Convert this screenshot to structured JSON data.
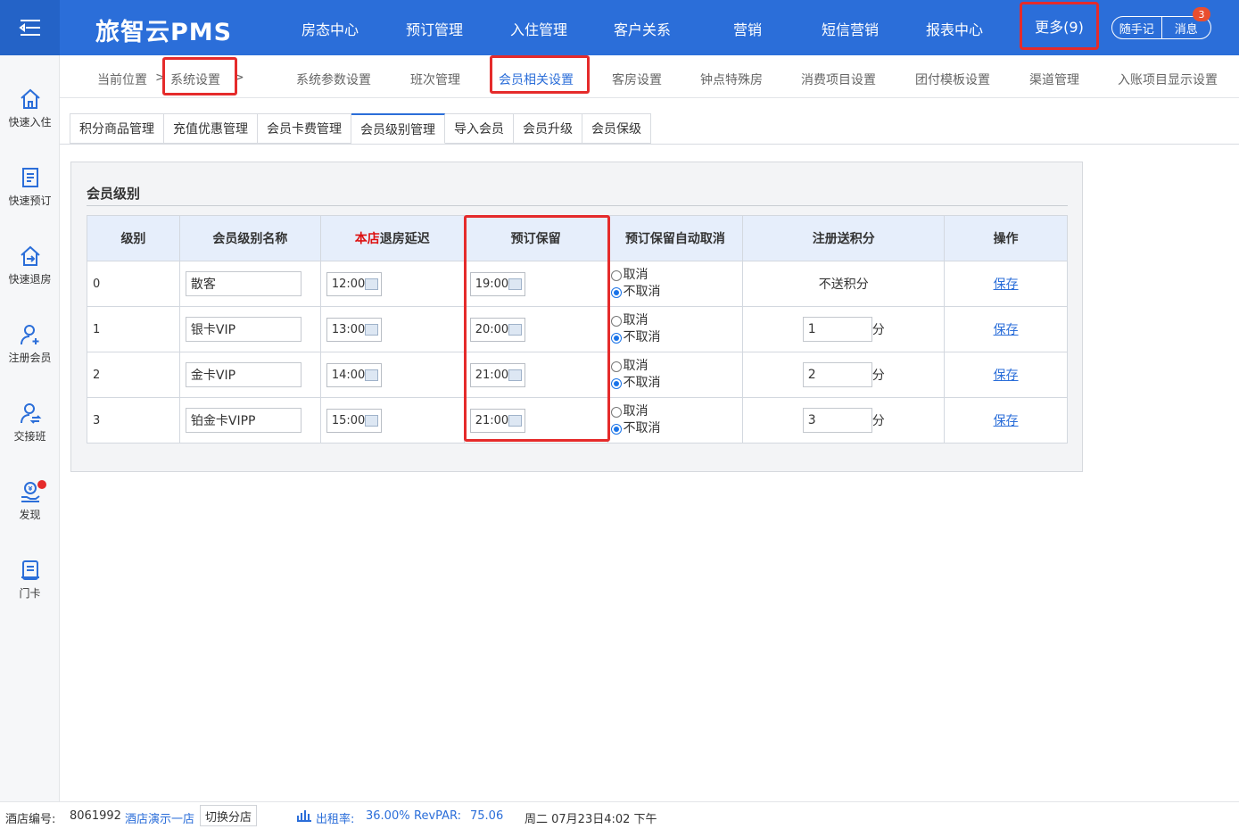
{
  "header": {
    "logo": "旅智云PMS",
    "nav": [
      "房态中心",
      "预订管理",
      "入住管理",
      "客户关系",
      "营销",
      "短信营销",
      "报表中心"
    ],
    "more": "更多(9)",
    "notes": "随手记",
    "messages": "消息",
    "message_count": "3"
  },
  "sidebar": {
    "items": [
      "快速入住",
      "快速预订",
      "快速退房",
      "注册会员",
      "交接班",
      "发现",
      "门卡"
    ]
  },
  "breadcrumb": {
    "current_label": "当前位置",
    "sep": ">",
    "section": "系统设置",
    "sub": [
      "系统参数设置",
      "班次管理",
      "会员相关设置",
      "客房设置",
      "钟点特殊房",
      "消费项目设置",
      "团付模板设置",
      "渠道管理",
      "入账项目显示设置"
    ]
  },
  "tabs": [
    "积分商品管理",
    "充值优惠管理",
    "会员卡费管理",
    "会员级别管理",
    "导入会员",
    "会员升级",
    "会员保级"
  ],
  "panel": {
    "title": "会员级别",
    "columns": {
      "level": "级别",
      "name": "会员级别名称",
      "checkout_prefix": "本店",
      "checkout_suffix": "退房延迟",
      "reserve": "预订保留",
      "auto_cancel": "预订保留自动取消",
      "points": "注册送积分",
      "action": "操作"
    },
    "cancel_label": "取消",
    "no_cancel_label": "不取消",
    "points_unit": "分",
    "save_label": "保存",
    "rows": [
      {
        "level": "0",
        "name": "散客",
        "checkout": "12:00",
        "reserve": "19:00",
        "points": "不送积分"
      },
      {
        "level": "1",
        "name": "银卡VIP",
        "checkout": "13:00",
        "reserve": "20:00",
        "points": "1"
      },
      {
        "level": "2",
        "name": "金卡VIP",
        "checkout": "14:00",
        "reserve": "21:00",
        "points": "2"
      },
      {
        "level": "3",
        "name": "铂金卡VIPP",
        "checkout": "15:00",
        "reserve": "21:00",
        "points": "3"
      }
    ]
  },
  "status": {
    "hotel_no_label": "酒店编号:",
    "hotel_no": "8061992",
    "hotel_name": "酒店演示一店",
    "switch": "切换分店",
    "occupancy_label": "出租率:",
    "occupancy": "36.00%",
    "revpar_label": "RevPAR:",
    "revpar": "75.06",
    "datetime": "周二 07月23日4:02 下午"
  }
}
